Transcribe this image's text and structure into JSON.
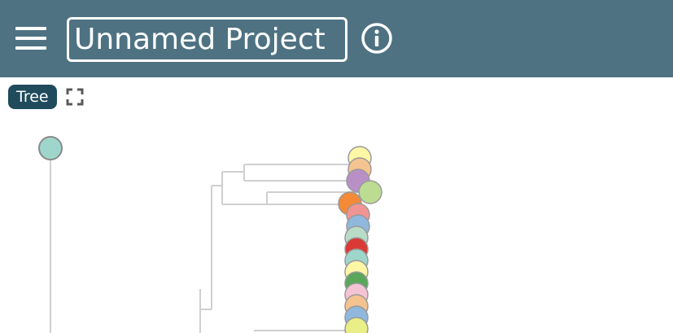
{
  "header": {
    "project_title": "Unnamed Project",
    "menu_icon": "hamburger-menu-icon",
    "info_icon": "info-icon"
  },
  "toolbar": {
    "view_tab_label": "Tree",
    "fullscreen_icon": "fullscreen-icon"
  },
  "colors": {
    "header_bg": "#4e7282",
    "tab_bg": "#1f4b5c",
    "root_node": "#9fd6cb",
    "tree_lines": "#c8c8c8"
  },
  "tree": {
    "node_colors": [
      "#fdf7a6",
      "#f5c390",
      "#b890c6",
      "#bcdc92",
      "#f48a38",
      "#f19494",
      "#8fb8dc",
      "#b8dcc8",
      "#d93a35",
      "#9fd6cb",
      "#fdf7a6",
      "#5aa65a",
      "#f4c4d4",
      "#f5c390",
      "#8fb8dc",
      "#e9ef86"
    ]
  }
}
